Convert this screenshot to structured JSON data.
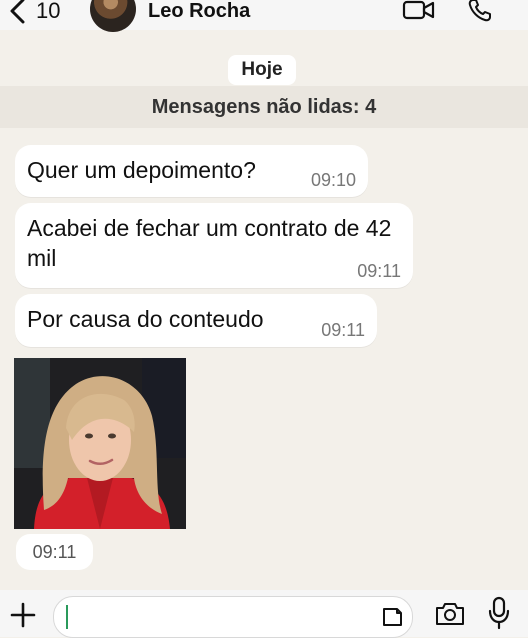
{
  "header": {
    "back_count": "10",
    "contact_name": "Leo Rocha",
    "icons": [
      "chevron-left-icon",
      "video-call-icon",
      "phone-icon"
    ]
  },
  "chat": {
    "date_chip": "Hoje",
    "unread_banner": "Mensagens não lidas: 4",
    "messages": [
      {
        "text": "Quer um depoimento?",
        "time": "09:10"
      },
      {
        "text": "Acabei de fechar um contrato de 42 mil",
        "time": "09:11"
      },
      {
        "text": "Por causa do conteudo",
        "time": "09:11"
      }
    ],
    "sticker_time": "09:11"
  },
  "composer": {
    "placeholder": "",
    "icons": [
      "plus-icon",
      "sticker-icon",
      "camera-icon",
      "mic-icon"
    ]
  },
  "colors": {
    "chat_background": "#f3f0ea",
    "bubble": "#ffffff",
    "caret": "#2a9a5b"
  }
}
